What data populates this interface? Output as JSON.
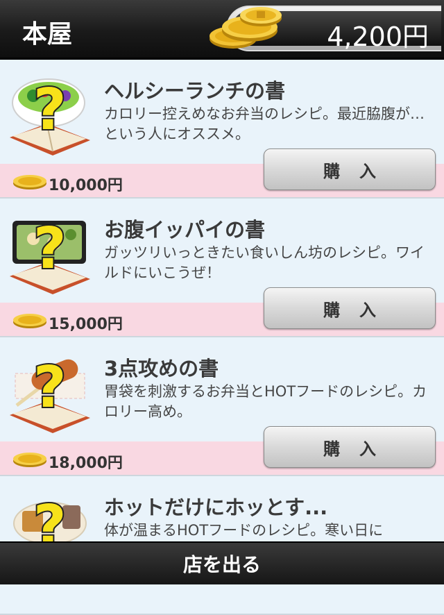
{
  "header": {
    "title": "本屋",
    "balance": "4,200円",
    "coins_icon": "gold-coins-stack-icon"
  },
  "items": [
    {
      "title": "ヘルシーランチの書",
      "description": "カロリー控えめなお弁当のレシピ。最近脇腹が…という人にオススメ。",
      "price": "10,000円",
      "buy_label": "購入",
      "thumb_icon": "salad-recipe-book-icon"
    },
    {
      "title": "お腹イッパイの書",
      "description": "ガッツリいっときたい食いしん坊のレシピ。ワイルドにいこうぜ！",
      "price": "15,000円",
      "buy_label": "購入",
      "thumb_icon": "bento-recipe-book-icon"
    },
    {
      "title": "3点攻めの書",
      "description": "胃袋を刺激するお弁当とHOTフードのレシピ。カロリー高め。",
      "price": "18,000円",
      "buy_label": "購入",
      "thumb_icon": "corndog-recipe-book-icon"
    },
    {
      "title": "ホットだけにホッとす...",
      "description": "体が温まるHOTフードのレシピ。寒い日に",
      "thumb_icon": "oden-recipe-book-icon"
    }
  ],
  "footer": {
    "exit_label": "店を出る"
  },
  "colors": {
    "list_bg": "#e9f3fa",
    "price_band": "#f9d8e2",
    "header_bg": "#1a1a1a",
    "question_mark": "#f7e21a"
  }
}
